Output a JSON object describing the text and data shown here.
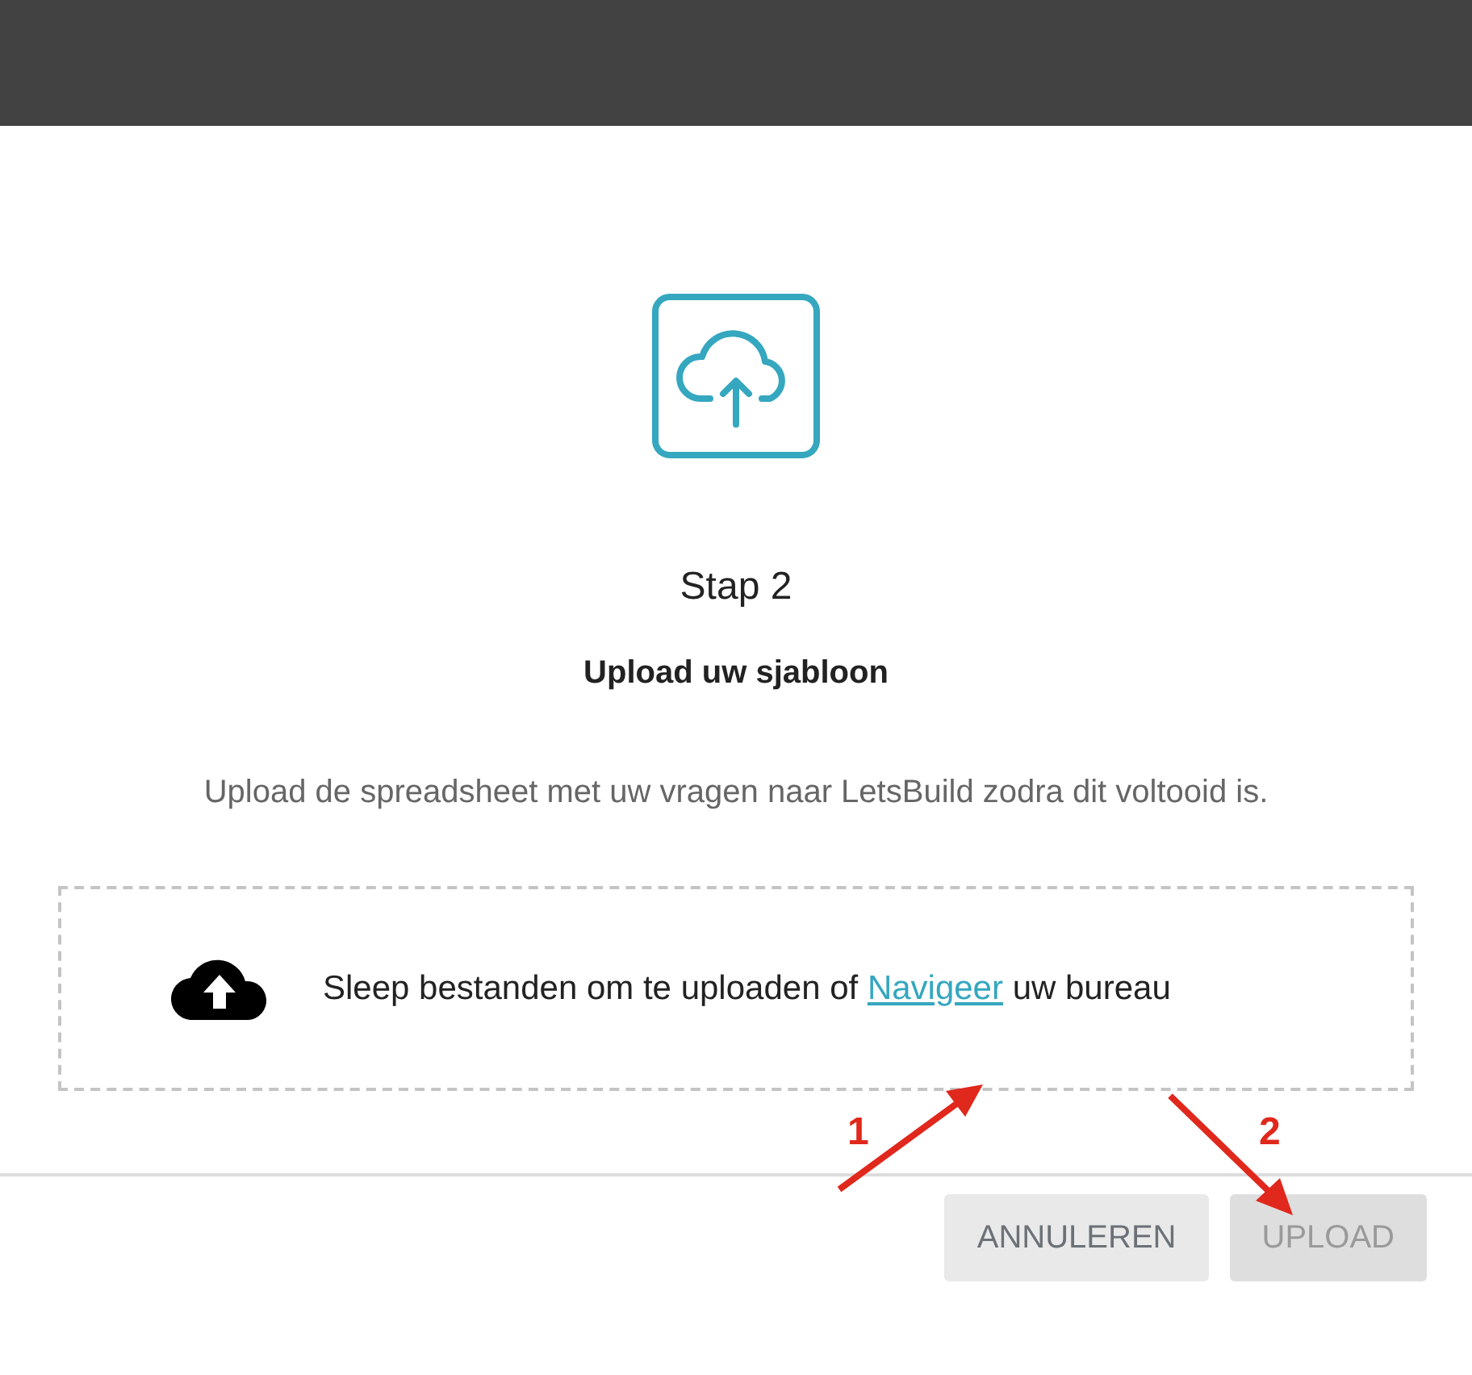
{
  "dialog": {
    "step": "Stap 2",
    "heading": "Upload uw sjabloon",
    "description": "Upload de spreadsheet met uw vragen naar LetsBuild zodra dit voltooid is.",
    "dropzone": {
      "text_before": "Sleep bestanden om te uploaden of",
      "link": "Navigeer",
      "text_after": "uw bureau"
    },
    "buttons": [
      {
        "label": "ANNULEREN",
        "disabled": false
      },
      {
        "label": "UPLOAD",
        "disabled": true
      }
    ]
  },
  "annotations": [
    {
      "label": "1"
    },
    {
      "label": "2"
    }
  ]
}
